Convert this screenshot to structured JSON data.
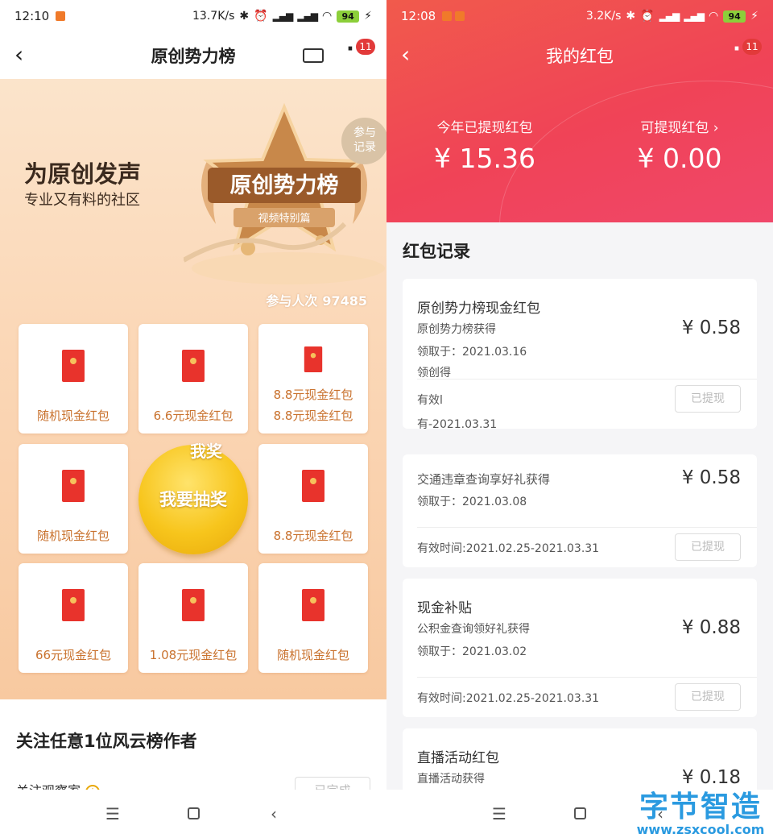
{
  "left": {
    "status": {
      "time": "12:10",
      "speed": "13.7K/s",
      "battery": "94"
    },
    "nav": {
      "title": "原创势力榜",
      "badge": "11"
    },
    "banner": {
      "slogan": "为原创发声",
      "sub_slogan": "专业又有料的社区",
      "emblem_title": "原创势力榜",
      "emblem_subtitle": "视频特别篇",
      "record_button": [
        "参与",
        "记录"
      ],
      "participants_label": "参与人次",
      "participants_count": "97485"
    },
    "grid": [
      {
        "label": "随机现金红包"
      },
      {
        "label": "6.6元现金红包"
      },
      {
        "label": "8.8元现金红包",
        "label2": "8.8元现金红包"
      },
      {
        "label": "随机现金红包"
      },
      {
        "label": "8.8元现金红包"
      },
      {
        "label": "66元现金红包"
      },
      {
        "label": "1.08元现金红包"
      },
      {
        "label": "随机现金红包"
      }
    ],
    "draw_button": {
      "label": "我要抽奖",
      "tag": "我奖"
    },
    "follow": {
      "title": "关注任意1位风云榜作者",
      "item": "关注观察家",
      "status": "已完成"
    }
  },
  "right": {
    "status": {
      "time": "12:08",
      "speed": "3.2K/s",
      "battery": "94"
    },
    "nav": {
      "title": "我的红包",
      "badge": "11"
    },
    "stats": {
      "withdrawn_label": "今年已提现红包",
      "withdrawn_value": "¥ 15.36",
      "available_label": "可提现红包 ›",
      "available_value": "¥ 0.00"
    },
    "records_title": "红包记录",
    "records": [
      {
        "name": "原创势力榜现金红包",
        "source": "原创势力榜获得",
        "date": "领取于：2021.03.16",
        "extra1": "领创得",
        "valid": "有效l",
        "extra2": "有-2021.03.31",
        "amount": "¥ 0.58",
        "button": "已提现"
      },
      {
        "name": "",
        "source": "交通违章查询享好礼获得",
        "date": "领取于：2021.03.08",
        "valid": "有效时间:2021.02.25-2021.03.31",
        "amount": "¥ 0.58",
        "button": "已提现"
      },
      {
        "name": "现金补贴",
        "source": "公积金查询领好礼获得",
        "date": "领取于：2021.03.02",
        "valid": "有效时间:2021.02.25-2021.03.31",
        "amount": "¥ 0.88",
        "button": "已提现"
      },
      {
        "name": "直播活动红包",
        "source": "直播活动获得",
        "amount": "¥ 0.18"
      }
    ],
    "watermark": {
      "main": "字节智造",
      "url": "www.zsxcool.com"
    }
  },
  "colors": {
    "brand_red": "#f04357",
    "gold": "#f7c51c",
    "envelope_red": "#e8332c",
    "prize_text": "#c9722e"
  }
}
